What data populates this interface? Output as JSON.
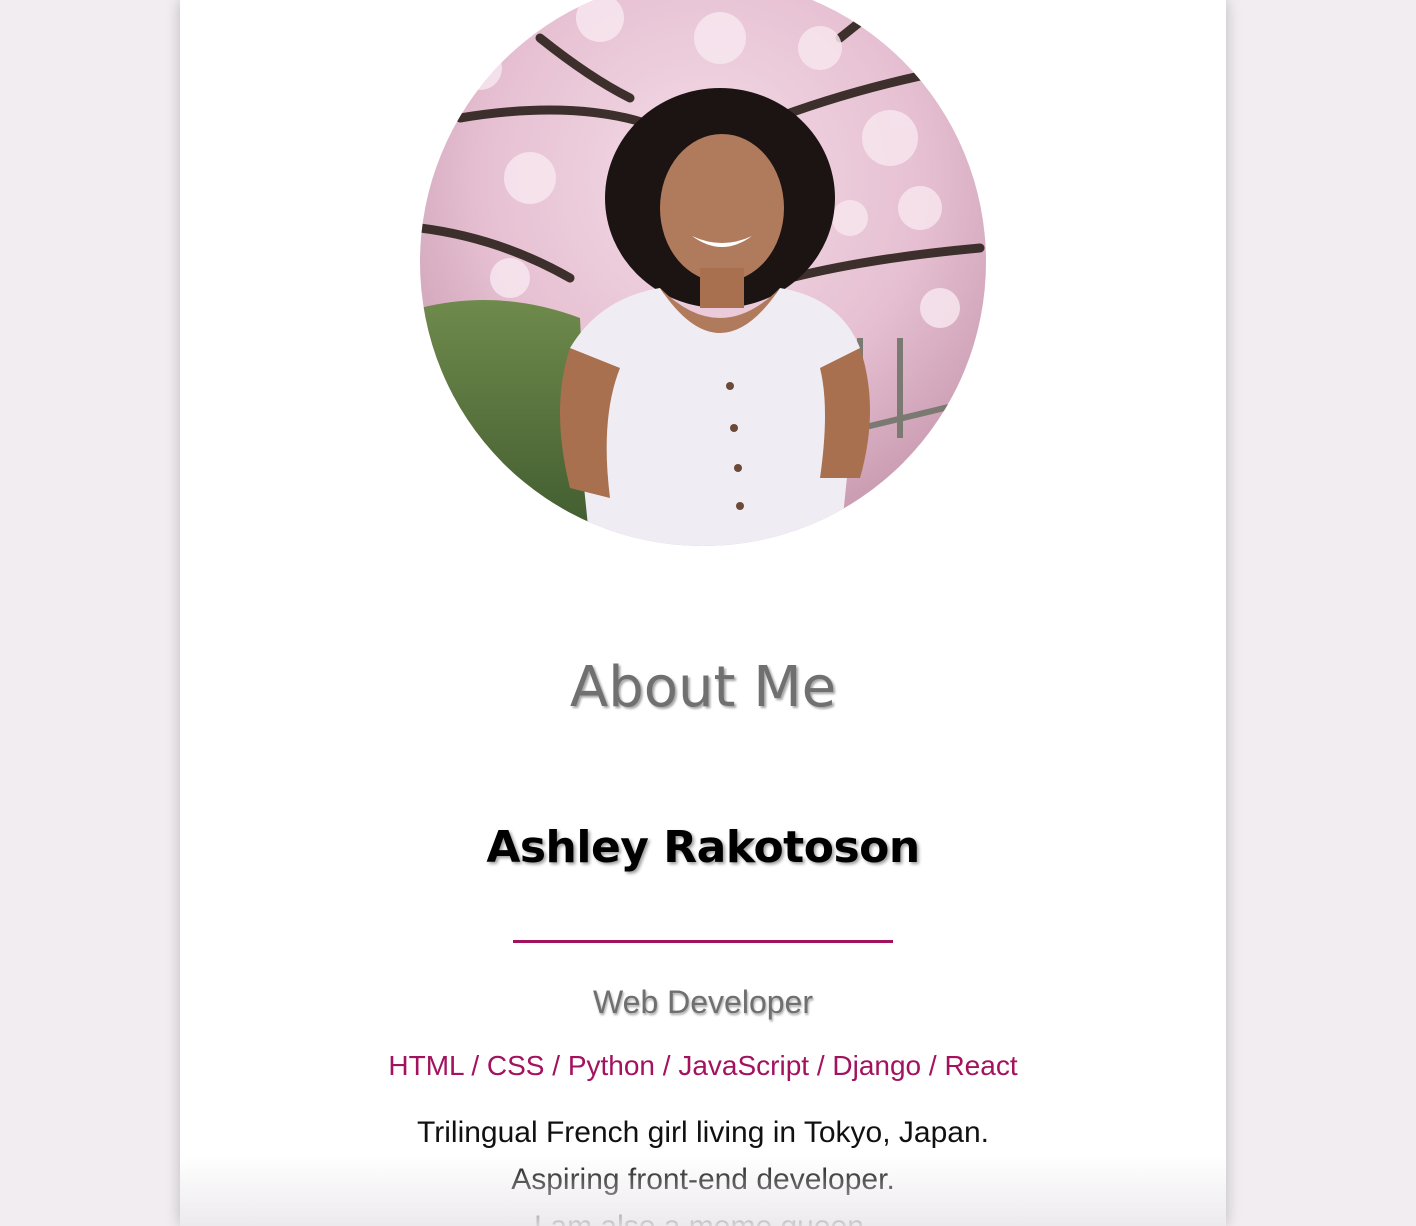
{
  "profile": {
    "section_title": "About Me",
    "name": "Ashley Rakotoson",
    "role": "Web Developer",
    "skills": "HTML / CSS / Python / JavaScript / Django / React",
    "bio_lines": [
      "Trilingual French girl living in Tokyo, Japan.",
      "Aspiring front-end developer.",
      "I am also a meme queen."
    ]
  },
  "colors": {
    "accent": "#a3125e",
    "page_background": "#f1edf1",
    "card_background": "#ffffff",
    "heading_gray": "#707070"
  },
  "icons": {
    "portrait": "profile-photo"
  }
}
